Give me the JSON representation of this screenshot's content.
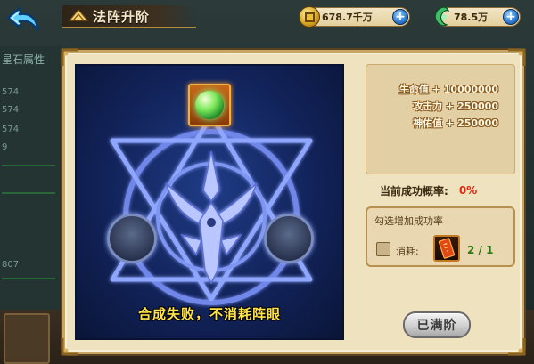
{
  "header": {
    "title": "法阵升阶",
    "currency_coins": "678.7千万",
    "currency_jade": "78.5万",
    "plus_symbol": "+"
  },
  "background": {
    "left_title": "星石属性",
    "left_numbers": [
      "574",
      "574",
      "574",
      "9",
      "807"
    ]
  },
  "array": {
    "fail_message": "合成失败，不消耗阵眼"
  },
  "stats": {
    "lines": [
      "生命值 + 10000000",
      "攻击力 + 250000",
      "神佑值 + 250000"
    ]
  },
  "success_rate": {
    "label": "当前成功概率:",
    "value": "0%"
  },
  "boost": {
    "title": "勾选增加成功率",
    "consume_label": "消耗:",
    "count": "2 / 1"
  },
  "action": {
    "maxed_label": "已满阶"
  },
  "colors": {
    "dialog_bg": "#efe2be",
    "frame_gold": "#c7a664",
    "array_blue": "#1f3c86",
    "fail_text": "#ffe34a",
    "rate_red": "#e02a10",
    "count_green": "#2a7a10"
  },
  "icons": [
    "back-arrow-icon",
    "title-emblem-icon",
    "coin-icon",
    "jade-icon",
    "plus-icon",
    "gem-icon",
    "talisman-icon"
  ]
}
